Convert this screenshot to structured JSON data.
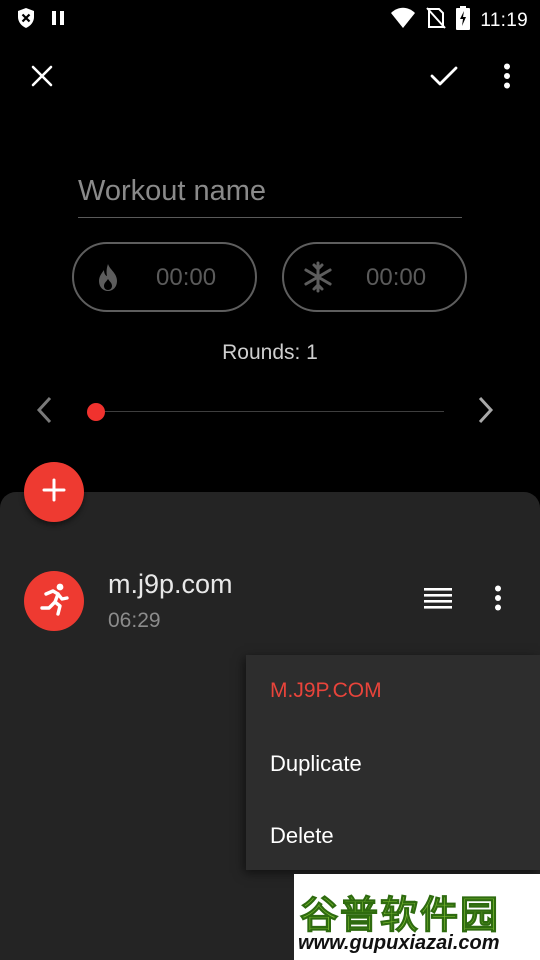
{
  "status_bar": {
    "time": "11:19",
    "icons": [
      "shield-icon",
      "pause-icon",
      "wifi-icon",
      "no-sim-icon",
      "battery-charging-icon"
    ]
  },
  "toolbar": {
    "close_icon": "close-icon",
    "confirm_icon": "check-icon",
    "more_icon": "more-vert-icon"
  },
  "workout": {
    "name_placeholder": "Workout name",
    "name_value": "",
    "warmup": {
      "icon": "flame-icon",
      "time": "00:00"
    },
    "cooldown": {
      "icon": "snowflake-icon",
      "time": "00:00"
    },
    "rounds_label": "Rounds: 1",
    "round_progress": 0
  },
  "colors": {
    "accent": "#ee3a31",
    "sheet_bg": "#242424",
    "menu_bg": "#2d2d2d",
    "menu_header": "#e8443b"
  },
  "exercise": {
    "title": "m.j9p.com",
    "duration": "06:29",
    "icon": "running-person-icon"
  },
  "context_menu": {
    "header": "M.J9P.COM",
    "items": [
      "Duplicate",
      "Delete"
    ]
  },
  "watermark": {
    "chinese": "谷普软件园",
    "url": "www.gupuxiazai.com"
  }
}
